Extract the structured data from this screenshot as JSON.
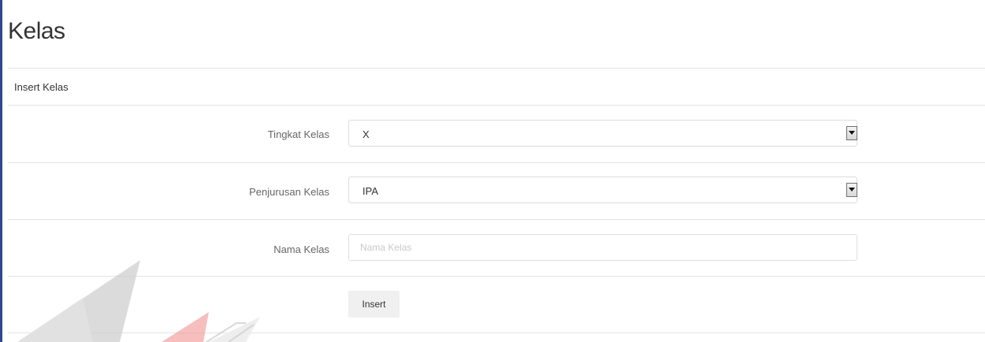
{
  "page": {
    "title": "Kelas"
  },
  "panel": {
    "heading": "Insert Kelas"
  },
  "form": {
    "tingkat": {
      "label": "Tingkat Kelas",
      "selected": "X"
    },
    "penjurusan": {
      "label": "Penjurusan Kelas",
      "selected": "IPA"
    },
    "nama": {
      "label": "Nama Kelas",
      "placeholder": "Nama Kelas",
      "value": ""
    },
    "submit_label": "Insert"
  },
  "colors": {
    "accent_bar": "#2e4a8c",
    "border": "#e3e3e3",
    "button_bg": "#f0f0f0",
    "watermark_gray": "#c8c8c8",
    "watermark_red": "#f08a8a"
  },
  "icons": {
    "select_arrow": "triangle-down",
    "watermark": "university-logo-watermark"
  }
}
